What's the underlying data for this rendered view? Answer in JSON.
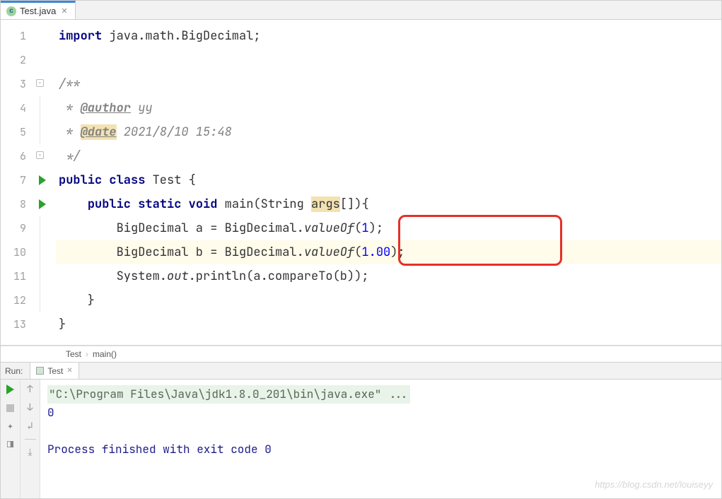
{
  "tab": {
    "filename": "Test.java"
  },
  "gutter_lines": [
    "1",
    "2",
    "3",
    "4",
    "5",
    "6",
    "7",
    "8",
    "9",
    "10",
    "11",
    "12",
    "13",
    " "
  ],
  "code": {
    "l1_kw": "import",
    "l1_rest": " java.math.BigDecimal;",
    "l3": "/**",
    "l4_pre": " * ",
    "l4_tag": "@author",
    "l4_post": " yy",
    "l5_pre": " * ",
    "l5_tag": "@date",
    "l5_post": " 2021/8/10 15:48",
    "l6": " */",
    "l7_kw1": "public",
    "l7_kw2": "class",
    "l7_name": " Test {",
    "l8_pre": "    ",
    "l8_kw1": "public",
    "l8_kw2": "static",
    "l8_kw3": "void",
    "l8_name": " main(String ",
    "l8_args": "args",
    "l8_end": "[]){",
    "l9_pre": "        BigDecimal a = BigDecimal.",
    "l9_m": "valueOf",
    "l9_p1": "(",
    "l9_n": "1",
    "l9_p2": ");",
    "l10_pre": "        BigDecimal b = BigDecimal.",
    "l10_m": "valueOf",
    "l10_p1": "(",
    "l10_n": "1.00",
    "l10_p2": ");",
    "l11_pre": "        System.",
    "l11_out": "out",
    "l11_rest": ".println(a.compareTo(b));",
    "l12": "    }",
    "l13": "}"
  },
  "breadcrumb": {
    "class": "Test",
    "method": "main()"
  },
  "run": {
    "label": "Run:",
    "config": "Test",
    "cmd": "\"C:\\Program Files\\Java\\jdk1.8.0_201\\bin\\java.exe\" ...",
    "output": "0",
    "exit": "Process finished with exit code 0"
  },
  "watermark": "https://blog.csdn.net/louiseyy"
}
